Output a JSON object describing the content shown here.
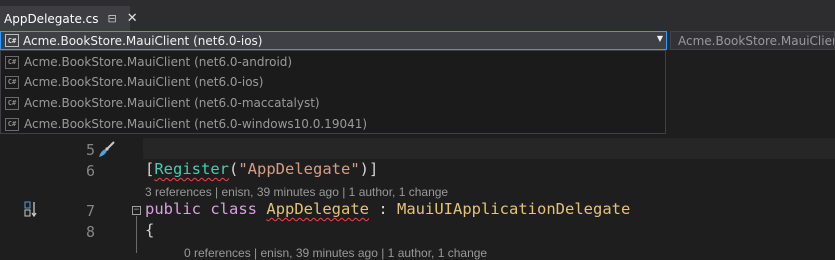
{
  "tab": {
    "title": "AppDelegate.cs",
    "pin_icon": "pin-icon",
    "close_icon": "close-icon",
    "pin_glyph": "⊟",
    "close_glyph": "✕"
  },
  "navbar": {
    "project_selected": "Acme.BookStore.MauiClient (net6.0-ios)",
    "type_selected": "Acme.BookStore.MauiClient",
    "dropdown_arrow": "▼",
    "cs_badge": "C#"
  },
  "dropdown": {
    "options": [
      "Acme.BookStore.MauiClient (net6.0-android)",
      "Acme.BookStore.MauiClient (net6.0-ios)",
      "Acme.BookStore.MauiClient (net6.0-maccatalyst)",
      "Acme.BookStore.MauiClient (net6.0-windows10.0.19041)"
    ]
  },
  "editor": {
    "lines": [
      {
        "number": "5"
      },
      {
        "number": "6",
        "open_bracket": "[",
        "attr": "Register",
        "open_paren": "(",
        "string": "\"AppDelegate\"",
        "close": ")]"
      },
      {
        "number": "7",
        "kw_public": "public",
        "kw_class": "class",
        "class_name": "AppDelegate",
        "colon": " : ",
        "base": "MauiUIApplicationDelegate"
      },
      {
        "number": "8",
        "brace": "{"
      }
    ],
    "codelens_class": "3 references | enisn, 39 minutes ago | 1 author, 1 change",
    "codelens_member": "0 references | enisn, 39 minutes ago | 1 author, 1 change",
    "outline_toggle": "−"
  },
  "colors": {
    "accent": "#3399ff",
    "background": "#1e1e1e",
    "keyword": "#569cd6",
    "type": "#4ec9b0",
    "string": "#d69d85"
  }
}
